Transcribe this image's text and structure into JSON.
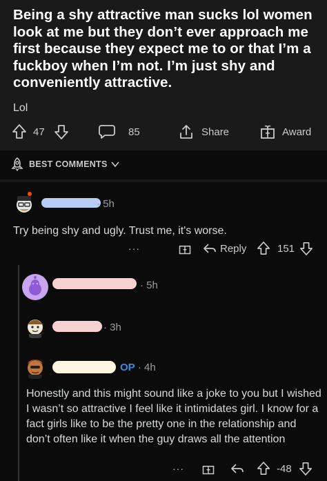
{
  "post": {
    "title": "Being a shy attractive man sucks lol women look at me but they don’t ever approach me first because they expect me to or that I’m a fuckboy when I’m not. I’m just shy and conveniently attractive.",
    "body": "Lol",
    "votes": "47",
    "comments": "85",
    "share_label": "Share",
    "award_label": "Award"
  },
  "sort": {
    "label": "BEST COMMENTS"
  },
  "comments": [
    {
      "time": "· 5h",
      "text": "Try being shy and ugly.  Trust me, it's worse.",
      "reply_label": "Reply",
      "votes": "151",
      "more": "···"
    },
    {
      "time": "· 5h"
    },
    {
      "time": "· 3h"
    },
    {
      "op_badge": "OP",
      "time": "· 4h",
      "text": "Honestly and this might sound like a joke to you but I wished I wasn’t so attractive I feel like it intimidates girl. I know for a fact girls like to be the pretty one in the relationship and don’t often like it when the guy draws all the attention",
      "votes": "-48",
      "more": "···"
    }
  ],
  "colors": {
    "background": "#0b0b0b",
    "card": "#1a1a1b",
    "op": "#3a8dde",
    "text": "#d7dadc"
  }
}
